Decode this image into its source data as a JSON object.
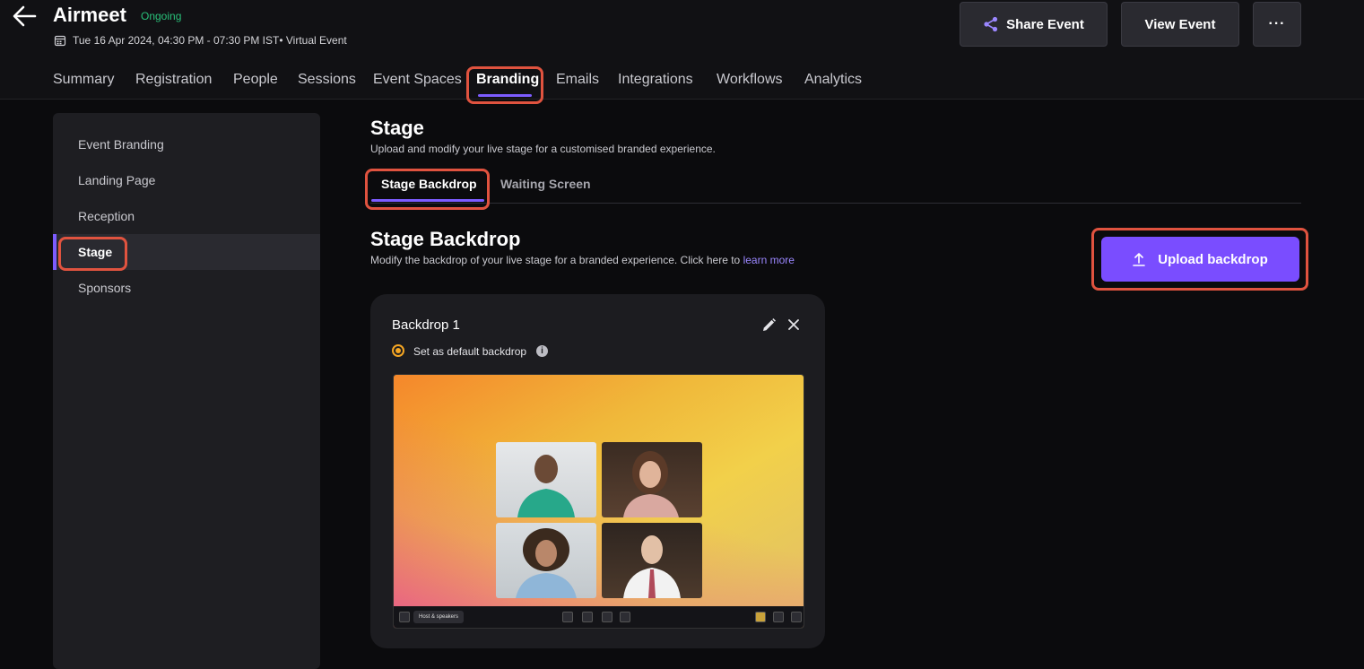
{
  "header": {
    "title": "Airmeet",
    "status": "Ongoing",
    "meta": "Tue 16 Apr 2024, 04:30 PM - 07:30 PM IST• Virtual Event",
    "share_label": "Share Event",
    "view_label": "View Event",
    "more_label": "···"
  },
  "nav": {
    "tabs": [
      {
        "label": "Summary"
      },
      {
        "label": "Registration"
      },
      {
        "label": "People"
      },
      {
        "label": "Sessions"
      },
      {
        "label": "Event Spaces"
      },
      {
        "label": "Branding"
      },
      {
        "label": "Emails"
      },
      {
        "label": "Integrations"
      },
      {
        "label": "Workflows"
      },
      {
        "label": "Analytics"
      }
    ],
    "active": "Branding"
  },
  "sidebar": {
    "items": [
      {
        "label": "Event Branding"
      },
      {
        "label": "Landing Page"
      },
      {
        "label": "Reception"
      },
      {
        "label": "Stage"
      },
      {
        "label": "Sponsors"
      }
    ],
    "active": "Stage"
  },
  "main": {
    "title": "Stage",
    "subtitle": "Upload and modify your live stage for a customised branded experience.",
    "tabs": [
      {
        "label": "Stage Backdrop"
      },
      {
        "label": "Waiting Screen"
      }
    ],
    "active_tab": "Stage Backdrop",
    "section_title": "Stage Backdrop",
    "section_desc": "Modify the backdrop of your live stage for a branded experience. Click here to",
    "learn_more": "learn more",
    "upload_label": "Upload backdrop"
  },
  "card": {
    "title": "Backdrop 1",
    "default_label": "Set as default backdrop",
    "info_glyph": "i",
    "preview_pill": "Host & speakers"
  },
  "colors": {
    "accent": "#7c5cff",
    "upload_button": "#7a4dff",
    "status_green": "#29c27a",
    "highlight": "#e0533f",
    "radio": "#f5a623"
  },
  "icons": {
    "back": "arrow-left-icon",
    "calendar": "calendar-icon",
    "share": "share-icon",
    "more": "more-horizontal-icon",
    "upload": "upload-icon",
    "edit": "pencil-icon",
    "close": "close-icon",
    "info": "info-icon"
  }
}
